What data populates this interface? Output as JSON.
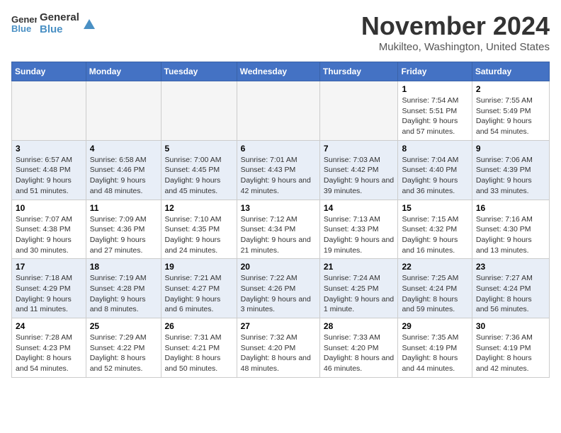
{
  "logo": {
    "line1": "General",
    "line2": "Blue"
  },
  "title": "November 2024",
  "location": "Mukilteo, Washington, United States",
  "headers": [
    "Sunday",
    "Monday",
    "Tuesday",
    "Wednesday",
    "Thursday",
    "Friday",
    "Saturday"
  ],
  "weeks": [
    [
      {
        "day": "",
        "info": ""
      },
      {
        "day": "",
        "info": ""
      },
      {
        "day": "",
        "info": ""
      },
      {
        "day": "",
        "info": ""
      },
      {
        "day": "",
        "info": ""
      },
      {
        "day": "1",
        "info": "Sunrise: 7:54 AM\nSunset: 5:51 PM\nDaylight: 9 hours and 57 minutes."
      },
      {
        "day": "2",
        "info": "Sunrise: 7:55 AM\nSunset: 5:49 PM\nDaylight: 9 hours and 54 minutes."
      }
    ],
    [
      {
        "day": "3",
        "info": "Sunrise: 6:57 AM\nSunset: 4:48 PM\nDaylight: 9 hours and 51 minutes."
      },
      {
        "day": "4",
        "info": "Sunrise: 6:58 AM\nSunset: 4:46 PM\nDaylight: 9 hours and 48 minutes."
      },
      {
        "day": "5",
        "info": "Sunrise: 7:00 AM\nSunset: 4:45 PM\nDaylight: 9 hours and 45 minutes."
      },
      {
        "day": "6",
        "info": "Sunrise: 7:01 AM\nSunset: 4:43 PM\nDaylight: 9 hours and 42 minutes."
      },
      {
        "day": "7",
        "info": "Sunrise: 7:03 AM\nSunset: 4:42 PM\nDaylight: 9 hours and 39 minutes."
      },
      {
        "day": "8",
        "info": "Sunrise: 7:04 AM\nSunset: 4:40 PM\nDaylight: 9 hours and 36 minutes."
      },
      {
        "day": "9",
        "info": "Sunrise: 7:06 AM\nSunset: 4:39 PM\nDaylight: 9 hours and 33 minutes."
      }
    ],
    [
      {
        "day": "10",
        "info": "Sunrise: 7:07 AM\nSunset: 4:38 PM\nDaylight: 9 hours and 30 minutes."
      },
      {
        "day": "11",
        "info": "Sunrise: 7:09 AM\nSunset: 4:36 PM\nDaylight: 9 hours and 27 minutes."
      },
      {
        "day": "12",
        "info": "Sunrise: 7:10 AM\nSunset: 4:35 PM\nDaylight: 9 hours and 24 minutes."
      },
      {
        "day": "13",
        "info": "Sunrise: 7:12 AM\nSunset: 4:34 PM\nDaylight: 9 hours and 21 minutes."
      },
      {
        "day": "14",
        "info": "Sunrise: 7:13 AM\nSunset: 4:33 PM\nDaylight: 9 hours and 19 minutes."
      },
      {
        "day": "15",
        "info": "Sunrise: 7:15 AM\nSunset: 4:32 PM\nDaylight: 9 hours and 16 minutes."
      },
      {
        "day": "16",
        "info": "Sunrise: 7:16 AM\nSunset: 4:30 PM\nDaylight: 9 hours and 13 minutes."
      }
    ],
    [
      {
        "day": "17",
        "info": "Sunrise: 7:18 AM\nSunset: 4:29 PM\nDaylight: 9 hours and 11 minutes."
      },
      {
        "day": "18",
        "info": "Sunrise: 7:19 AM\nSunset: 4:28 PM\nDaylight: 9 hours and 8 minutes."
      },
      {
        "day": "19",
        "info": "Sunrise: 7:21 AM\nSunset: 4:27 PM\nDaylight: 9 hours and 6 minutes."
      },
      {
        "day": "20",
        "info": "Sunrise: 7:22 AM\nSunset: 4:26 PM\nDaylight: 9 hours and 3 minutes."
      },
      {
        "day": "21",
        "info": "Sunrise: 7:24 AM\nSunset: 4:25 PM\nDaylight: 9 hours and 1 minute."
      },
      {
        "day": "22",
        "info": "Sunrise: 7:25 AM\nSunset: 4:24 PM\nDaylight: 8 hours and 59 minutes."
      },
      {
        "day": "23",
        "info": "Sunrise: 7:27 AM\nSunset: 4:24 PM\nDaylight: 8 hours and 56 minutes."
      }
    ],
    [
      {
        "day": "24",
        "info": "Sunrise: 7:28 AM\nSunset: 4:23 PM\nDaylight: 8 hours and 54 minutes."
      },
      {
        "day": "25",
        "info": "Sunrise: 7:29 AM\nSunset: 4:22 PM\nDaylight: 8 hours and 52 minutes."
      },
      {
        "day": "26",
        "info": "Sunrise: 7:31 AM\nSunset: 4:21 PM\nDaylight: 8 hours and 50 minutes."
      },
      {
        "day": "27",
        "info": "Sunrise: 7:32 AM\nSunset: 4:20 PM\nDaylight: 8 hours and 48 minutes."
      },
      {
        "day": "28",
        "info": "Sunrise: 7:33 AM\nSunset: 4:20 PM\nDaylight: 8 hours and 46 minutes."
      },
      {
        "day": "29",
        "info": "Sunrise: 7:35 AM\nSunset: 4:19 PM\nDaylight: 8 hours and 44 minutes."
      },
      {
        "day": "30",
        "info": "Sunrise: 7:36 AM\nSunset: 4:19 PM\nDaylight: 8 hours and 42 minutes."
      }
    ]
  ]
}
